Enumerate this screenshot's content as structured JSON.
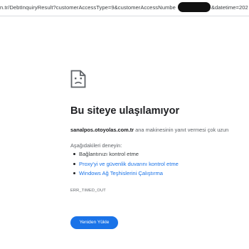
{
  "address_bar": {
    "url_visible": "n.tr/DebtInquiryResult?customerAccessType=9&customerAccessNumbe",
    "url_tail": "&datetime=202"
  },
  "error_page": {
    "title": "Bu siteye ulaşılamıyor",
    "host": "sanalpos.otoyolas.com.tr",
    "description_rest": " ana makinesinin yanıt vermesi çok uzun",
    "try_heading": "Aşağıdakileri deneyin:",
    "suggestions": {
      "check_connection": "Bağlantınızı kontrol etme",
      "check_proxy": "Proxy'yi ve güvenlik duvarını kontrol etme",
      "run_diagnostics": "Windows Ağ Teşhislerini Çalıştırma"
    },
    "error_code": "ERR_TIMED_OUT",
    "reload_label": "Yeniden Yükle"
  },
  "icons": {
    "page_icon": "sad-document-icon"
  },
  "colors": {
    "link": "#1a73e8",
    "button_bg": "#1a73e8",
    "title_text": "#202124",
    "secondary_text": "#5f6368"
  }
}
